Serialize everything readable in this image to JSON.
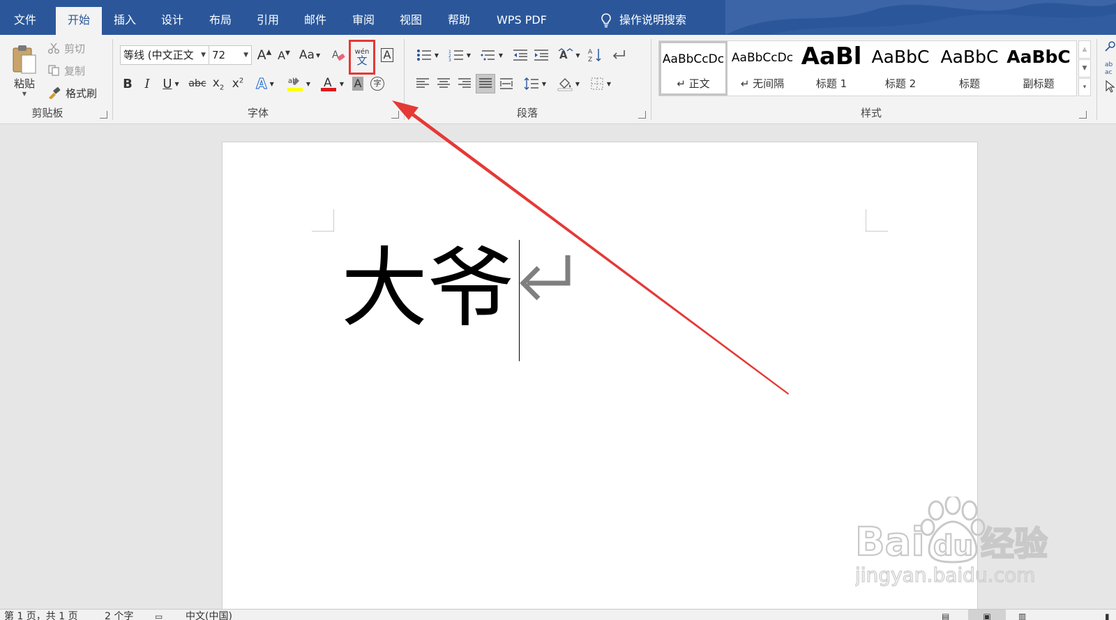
{
  "tabs": [
    "文件",
    "开始",
    "插入",
    "设计",
    "布局",
    "引用",
    "邮件",
    "审阅",
    "视图",
    "帮助",
    "WPS PDF"
  ],
  "active_tab": "开始",
  "tell_me": "操作说明搜索",
  "clipboard": {
    "label": "剪贴板",
    "paste": "粘贴",
    "cut": "剪切",
    "copy": "复制",
    "format_painter": "格式刷"
  },
  "font": {
    "label": "字体",
    "font_name": "等线 (中文正文",
    "font_size": "72",
    "change_case": "Aa",
    "phonetic_top": "wén",
    "phonetic_char": "文"
  },
  "paragraph": {
    "label": "段落"
  },
  "styles": {
    "label": "样式",
    "items": [
      {
        "sample": "AaBbCcDc",
        "name": "↵ 正文"
      },
      {
        "sample": "AaBbCcDc",
        "name": "↵ 无间隔"
      },
      {
        "sample": "AaBl",
        "name": "标题 1"
      },
      {
        "sample": "AaBbC",
        "name": "标题 2"
      },
      {
        "sample": "AaBbC",
        "name": "标题"
      },
      {
        "sample": "AaBbC",
        "name": "副标题"
      }
    ]
  },
  "document": {
    "text": "大爷"
  },
  "status": {
    "page": "第 1 页，共 1 页",
    "words": "2 个字",
    "language": "中文(中国)"
  },
  "watermark": {
    "brand": "Bai",
    "brand2": "du",
    "cn": "经验",
    "url": "jingyan.baidu.com"
  },
  "colors": {
    "tab_bar": "#2b579a",
    "ribbon": "#f3f3f3",
    "canvas": "#e6e6e6",
    "highlight_red": "#e53935",
    "font_color_red": "#e0191b",
    "highlight_yellow": "#ffff00"
  }
}
